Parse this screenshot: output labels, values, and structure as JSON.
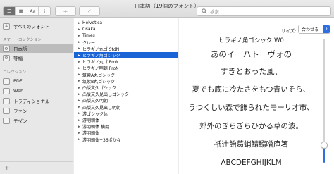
{
  "window": {
    "title": "日本語（19個のフォント）"
  },
  "toolbar": {
    "sidebar_toggle_glyph": "☰",
    "grid_glyph": "▦",
    "sample_glyph": "Aa",
    "info_glyph": "i",
    "add_glyph": "+",
    "check_glyph": "✓",
    "search_placeholder": "検索"
  },
  "sidebar": {
    "all_fonts": "すべてのフォント",
    "smart_collections_header": "スマートコレクション",
    "smart": [
      {
        "label": "日本語",
        "icon": "gear"
      },
      {
        "label": "等幅",
        "icon": "gear"
      }
    ],
    "collections_header": "コレクション",
    "collections": [
      {
        "label": "PDF"
      },
      {
        "label": "Web"
      },
      {
        "label": "トラディショナル"
      },
      {
        "label": "ファン"
      },
      {
        "label": "モダン"
      }
    ],
    "add_glyph": "+"
  },
  "font_list": [
    "Helvetica",
    "Osaka",
    "Times",
    "クレー",
    "ヒラギノ丸ゴ StdN",
    "ヒラギノ角ゴシック",
    "ヒラギノ丸ゴ ProN",
    "ヒラギノ明朝 ProN",
    "筑紫A丸ゴシック",
    "筑紫B丸ゴシック",
    "凸版文久ゴシック",
    "凸版文久見出しゴシック",
    "凸版文久明朝",
    "凸版文久見出し明朝",
    "游ゴシック体",
    "游明朝体",
    "游明朝体 横用",
    "游明朝体",
    "游明朝体+36ポかな"
  ],
  "selected_font_index": 5,
  "preview": {
    "size_label": "サイズ:",
    "size_value": "合わせる",
    "lines": [
      "ヒラギノ角ゴシック W0",
      "あのイーハトーヴォの",
      "すきとおった風、",
      "夏でも底に冷たさをもつ青いそら、",
      "うつくしい森で飾られたモーリオ市、",
      "郊外のぎらぎらひかる草の波。",
      "祇辻飴葛蛸鯖鰯噌庖箸",
      "ABCDEFGHIJKLM"
    ],
    "slider_level": 0.14
  }
}
